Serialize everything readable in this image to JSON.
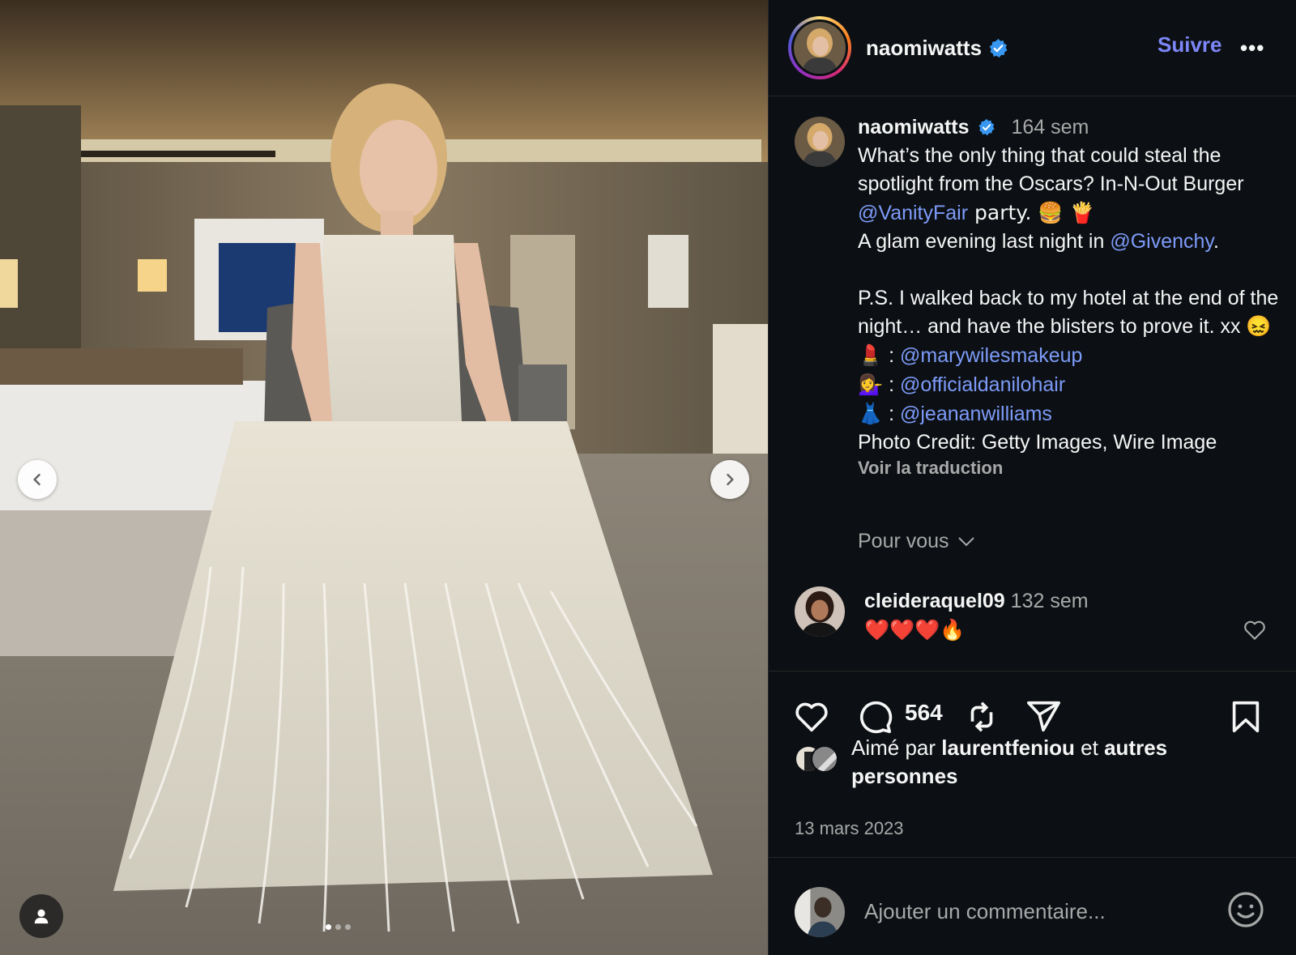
{
  "header": {
    "username": "naomiwatts",
    "follow_label": "Suivre",
    "more_label": "•••",
    "verified_icon": "verified-badge-icon"
  },
  "caption": {
    "username": "naomiwatts",
    "time": "164 sem",
    "line1a": "What’s the only thing that could steal the spotlight from the Oscars? In-N-Out Burger ",
    "mention1": "@VanityFair",
    "line1b": " party. 🍔 🍟",
    "line2a": "A glam evening last night in ",
    "mention2": "@Givenchy",
    "line2b": ".",
    "line3": "P.S. I walked back to my hotel at the end of the night… and have the blisters to prove it. xx 😖",
    "credit1_emoji": "💄",
    "credit1": "@marywilesmakeup",
    "credit2_emoji": "💁‍♀️",
    "credit2": "@officialdanilohair",
    "credit3_emoji": "👗",
    "credit3": "@jeananwilliams",
    "photo_credit": "Photo Credit: Getty Images, Wire Image",
    "translate": "Voir la traduction"
  },
  "filter": {
    "label": "Pour vous"
  },
  "comment": {
    "username": "cleideraquel09",
    "time": "132 sem",
    "text": "❤️❤️❤️🔥"
  },
  "actions": {
    "comment_count": "564"
  },
  "likes": {
    "prefix": "Aimé par ",
    "user": "laurentfeniou",
    "mid": " et ",
    "rest": "autres personnes"
  },
  "date": "13 mars 2023",
  "add_comment": {
    "placeholder": "Ajouter un commentaire..."
  },
  "colors": {
    "panel_bg": "#0c1014",
    "link": "#7d86f8",
    "mention": "#7d9bf8",
    "muted": "#a8a8a8",
    "verified": "#3897f0"
  }
}
